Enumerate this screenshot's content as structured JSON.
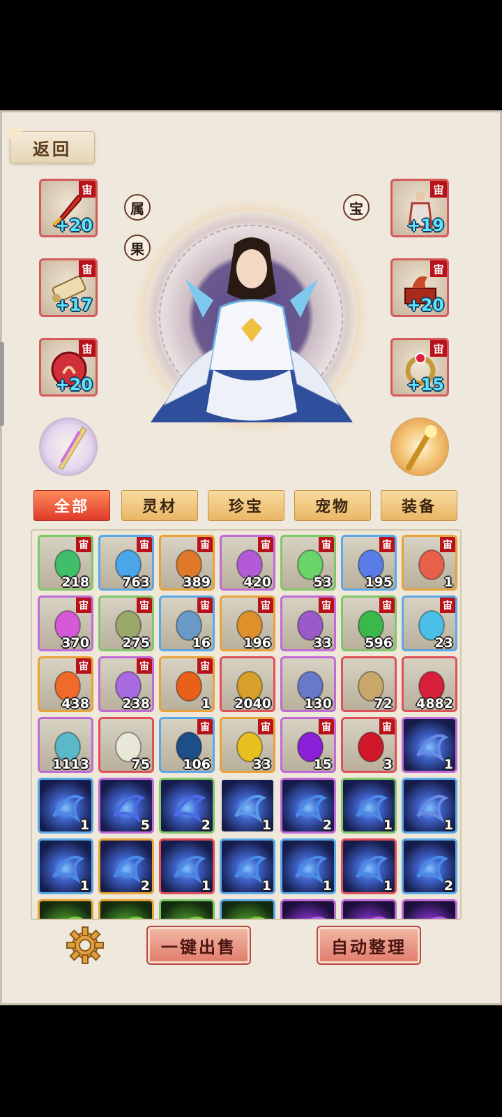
{
  "header": {
    "back_label": "返回"
  },
  "equipment": {
    "left": [
      {
        "name": "sword",
        "badge": "宙",
        "level": "+20",
        "color": "#d82a1a"
      },
      {
        "name": "scroll",
        "badge": "宙",
        "level": "+17",
        "color": "#e8d3a0"
      },
      {
        "name": "orb-seal",
        "badge": "宙",
        "level": "+20",
        "color": "#d0303a"
      }
    ],
    "right": [
      {
        "name": "armor-figure",
        "badge": "宙",
        "level": "+19",
        "color": "#b03a30"
      },
      {
        "name": "dragon-chest",
        "badge": "宙",
        "level": "+20",
        "color": "#b23a20"
      },
      {
        "name": "ring",
        "badge": "宙",
        "level": "+15",
        "color": "#c59a3a"
      }
    ]
  },
  "side_buttons": {
    "attr": "属",
    "fruit": "果",
    "treasure": "宝"
  },
  "tabs": [
    {
      "label": "全部",
      "active": true
    },
    {
      "label": "灵材",
      "active": false
    },
    {
      "label": "珍宝",
      "active": false
    },
    {
      "label": "宠物",
      "active": false
    },
    {
      "label": "装备",
      "active": false
    }
  ],
  "inventory": [
    {
      "icon": "coral-icon",
      "rarity": "green",
      "badge": "宙",
      "count": "218",
      "color": "#3fbf6a"
    },
    {
      "icon": "blue-flower-icon",
      "rarity": "blue",
      "badge": "宙",
      "count": "763",
      "color": "#4aa6e8"
    },
    {
      "icon": "ginseng-icon",
      "rarity": "orange",
      "badge": "宙",
      "count": "389",
      "color": "#e07a2a"
    },
    {
      "icon": "purple-mushroom-icon",
      "rarity": "purple",
      "badge": "宙",
      "count": "420",
      "color": "#b35ad6"
    },
    {
      "icon": "green-crystal-icon",
      "rarity": "green",
      "badge": "宙",
      "count": "53",
      "color": "#69d46a"
    },
    {
      "icon": "blue-crystal-icon",
      "rarity": "blue",
      "badge": "宙",
      "count": "195",
      "color": "#5a7ce8"
    },
    {
      "icon": "red-stone-icon",
      "rarity": "orange",
      "badge": "宙",
      "count": "1",
      "color": "#e8604a"
    },
    {
      "icon": "pink-crystal-icon",
      "rarity": "purple",
      "badge": "宙",
      "count": "370",
      "color": "#d65ad6"
    },
    {
      "icon": "green-cloth-icon",
      "rarity": "green",
      "badge": "宙",
      "count": "275",
      "color": "#9aa86a"
    },
    {
      "icon": "blue-cloth-icon",
      "rarity": "blue",
      "badge": "宙",
      "count": "16",
      "color": "#6a9ac8"
    },
    {
      "icon": "orange-cloth-icon",
      "rarity": "orange",
      "badge": "宙",
      "count": "196",
      "color": "#e0902a"
    },
    {
      "icon": "purple-cloth-icon",
      "rarity": "purple",
      "badge": "宙",
      "count": "33",
      "color": "#9a5ac8"
    },
    {
      "icon": "jade-leaf-icon",
      "rarity": "green",
      "badge": "宙",
      "count": "596",
      "color": "#3ab84a"
    },
    {
      "icon": "ice-crystal-icon",
      "rarity": "blue",
      "badge": "宙",
      "count": "23",
      "color": "#4ac0e8"
    },
    {
      "icon": "flame-crystal-icon",
      "rarity": "orange",
      "badge": "宙",
      "count": "438",
      "color": "#f06a2a"
    },
    {
      "icon": "amethyst-icon",
      "rarity": "purple",
      "badge": "宙",
      "count": "238",
      "color": "#a86ae0"
    },
    {
      "icon": "fire-pearl-icon",
      "rarity": "orange",
      "badge": "宙",
      "count": "1",
      "color": "#e8601a"
    },
    {
      "icon": "golden-root-icon",
      "rarity": "red",
      "badge": "",
      "count": "2040",
      "color": "#d8a02a"
    },
    {
      "icon": "blue-stone-icon",
      "rarity": "purple",
      "badge": "",
      "count": "130",
      "color": "#6a78c8"
    },
    {
      "icon": "jade-disc-icon",
      "rarity": "red",
      "badge": "",
      "count": "72",
      "color": "#c8a86a"
    },
    {
      "icon": "red-scepter-icon",
      "rarity": "red",
      "badge": "",
      "count": "4882",
      "color": "#d8203a"
    },
    {
      "icon": "book-icon",
      "rarity": "purple",
      "badge": "",
      "count": "1113",
      "color": "#5ab8c8"
    },
    {
      "icon": "white-jade-icon",
      "rarity": "red",
      "badge": "",
      "count": "75",
      "color": "#e8e8d8"
    },
    {
      "icon": "blue-egg-icon",
      "rarity": "blue",
      "badge": "宙",
      "count": "106",
      "color": "#1e4e8a"
    },
    {
      "icon": "gold-egg-icon",
      "rarity": "orange",
      "badge": "宙",
      "count": "33",
      "color": "#e8c020"
    },
    {
      "icon": "purple-egg-icon",
      "rarity": "purple",
      "badge": "宙",
      "count": "15",
      "color": "#8a20d8"
    },
    {
      "icon": "red-egg-icon",
      "rarity": "red",
      "badge": "宙",
      "count": "3",
      "color": "#d0182a"
    },
    {
      "icon": "shield-skill-icon",
      "rarity": "purple",
      "badge": "",
      "count": "1",
      "color": "#6a8ae8",
      "skill": "skill"
    },
    {
      "icon": "kick-skill-icon",
      "rarity": "blue",
      "badge": "",
      "count": "1",
      "color": "#4a8ae8",
      "skill": "skill"
    },
    {
      "icon": "claw-skill-icon",
      "rarity": "purple",
      "badge": "",
      "count": "5",
      "color": "#4a6ae8",
      "skill": "skill"
    },
    {
      "icon": "claw-skill-icon",
      "rarity": "green",
      "badge": "",
      "count": "2",
      "color": "#4a6ae8",
      "skill": "skill"
    },
    {
      "icon": "vortex-skill-icon",
      "rarity": "white",
      "badge": "",
      "count": "1",
      "color": "#5a9ae8",
      "skill": "skill"
    },
    {
      "icon": "slash-skill-icon",
      "rarity": "purple",
      "badge": "",
      "count": "2",
      "color": "#4a8ae8",
      "skill": "skill"
    },
    {
      "icon": "slash-skill-icon",
      "rarity": "green",
      "badge": "",
      "count": "1",
      "color": "#4a8ae8",
      "skill": "skill"
    },
    {
      "icon": "lightning-skill-icon",
      "rarity": "blue",
      "badge": "",
      "count": "1",
      "color": "#6a8ae8",
      "skill": "skill"
    },
    {
      "icon": "whirl-skill-icon",
      "rarity": "blue",
      "badge": "",
      "count": "1",
      "color": "#4a8ae8",
      "skill": "skill"
    },
    {
      "icon": "aura-skill-icon",
      "rarity": "orange",
      "badge": "",
      "count": "2",
      "color": "#4a8ae8",
      "skill": "skill"
    },
    {
      "icon": "aura-skill-icon",
      "rarity": "red",
      "badge": "",
      "count": "1",
      "color": "#4a8ae8",
      "skill": "skill"
    },
    {
      "icon": "vortex-skill-icon",
      "rarity": "blue",
      "badge": "",
      "count": "1",
      "color": "#4a8ae8",
      "skill": "skill"
    },
    {
      "icon": "vortex-skill-icon",
      "rarity": "blue",
      "badge": "",
      "count": "1",
      "color": "#4a8ae8",
      "skill": "skill"
    },
    {
      "icon": "vortex-skill-icon",
      "rarity": "red",
      "badge": "",
      "count": "1",
      "color": "#4a8ae8",
      "skill": "skill"
    },
    {
      "icon": "lotus-skill-icon",
      "rarity": "blue",
      "badge": "",
      "count": "2",
      "color": "#4a8ae8",
      "skill": "skill"
    },
    {
      "icon": "nature-skill-icon",
      "rarity": "orange",
      "badge": "",
      "count": "",
      "color": "#7ac83a",
      "skill": "skillg"
    },
    {
      "icon": "nature-skill-icon",
      "rarity": "orange",
      "badge": "",
      "count": "",
      "color": "#7ac83a",
      "skill": "skillg"
    },
    {
      "icon": "nature-skill-icon",
      "rarity": "green",
      "badge": "",
      "count": "",
      "color": "#7ac83a",
      "skill": "skillg"
    },
    {
      "icon": "nature-skill-icon",
      "rarity": "blue",
      "badge": "",
      "count": "",
      "color": "#7ac83a",
      "skill": "skillg"
    },
    {
      "icon": "void-skill-icon",
      "rarity": "purple",
      "badge": "",
      "count": "",
      "color": "#b05ae8",
      "skill": "skillp"
    },
    {
      "icon": "void-skill-icon",
      "rarity": "purple",
      "badge": "",
      "count": "",
      "color": "#b05ae8",
      "skill": "skillp"
    },
    {
      "icon": "void-skill-icon",
      "rarity": "purple",
      "badge": "",
      "count": "",
      "color": "#b05ae8",
      "skill": "skillp"
    }
  ],
  "footer": {
    "sell_label": "一键出售",
    "sort_label": "自动整理"
  }
}
